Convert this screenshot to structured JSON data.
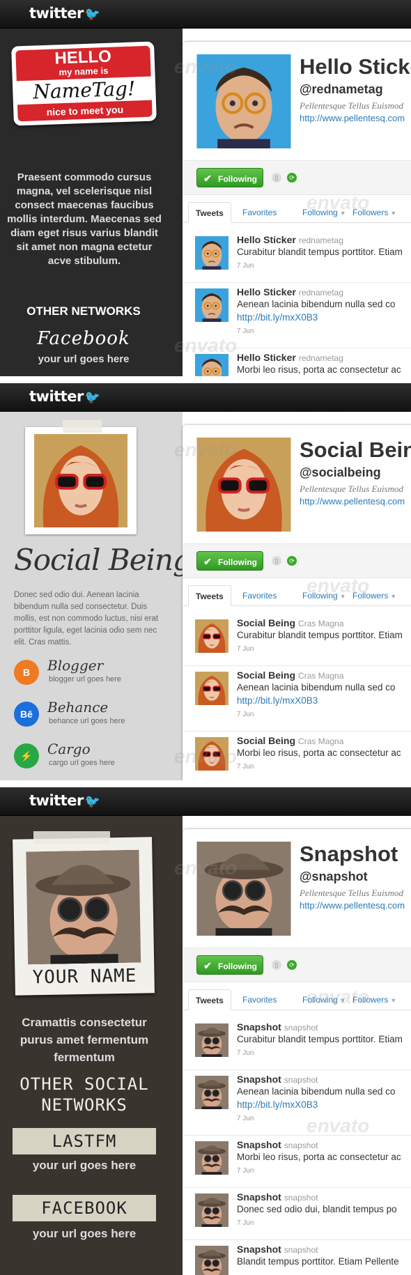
{
  "logo": "twitter",
  "common": {
    "following_btn": "Following",
    "tabs": [
      "Tweets",
      "Favorites",
      "Following",
      "Followers"
    ],
    "bio": "Pellentesque Tellus Euismod",
    "url": "http://www.pellentesq.com",
    "link": "http://bit.ly/mxX0B3",
    "date": "7 Jun",
    "watermark": "envato"
  },
  "colors": {
    "topbar": "#1a1a1a",
    "follow_green": "#3aa82a",
    "link_blue": "#2a7ab8",
    "nametag_red": "#d6252b"
  },
  "s1": {
    "tag_hello": "HELLO",
    "tag_myname": "my name is",
    "tag_name": "NameTag!",
    "tag_nice": "nice to meet you",
    "text": "Praesent commodo cursus magna, vel scelerisque nisl consect maecenas faucibus mollis interdum. Maecenas sed diam eget risus varius blandit sit amet non magna ectetur acve stibulum.",
    "other": "OTHER NETWORKS",
    "fb": "Facebook",
    "fb_url": "your url goes here",
    "profile_name": "Hello Sticker",
    "handle": "@rednametag",
    "tweets": [
      {
        "name": "Hello Sticker",
        "user": "rednametag",
        "text": "Curabitur blandit tempus porttitor. Etiam"
      },
      {
        "name": "Hello Sticker",
        "user": "rednametag",
        "text": "Aenean lacinia bibendum nulla sed co"
      },
      {
        "name": "Hello Sticker",
        "user": "rednametag",
        "text": "Morbi leo risus, porta ac consectetur ac"
      }
    ]
  },
  "s2": {
    "title": "Social Being",
    "text": "Donec sed odio dui. Aenean lacinia bibendum nulla sed consectetur. Duis mollis, est non commodo luctus, nisi erat porttitor ligula, eget lacinia odio sem nec elit. Cras mattis.",
    "networks": [
      {
        "name": "Blogger",
        "url": "blogger url goes here",
        "icon": "B",
        "color": "#f07a22"
      },
      {
        "name": "Behance",
        "url": "behance url goes here",
        "icon": "Bē",
        "color": "#1a6fdc"
      },
      {
        "name": "Cargo",
        "url": "cargo url goes here",
        "icon": "⚡",
        "color": "#27a845"
      }
    ],
    "profile_name": "Social Being",
    "handle": "@socialbeing",
    "tweets": [
      {
        "name": "Social Being",
        "user": "Cras Magna",
        "text": "Curabitur blandit tempus porttitor. Etiam"
      },
      {
        "name": "Social Being",
        "user": "Cras Magna",
        "text": "Aenean lacinia bibendum nulla sed co"
      },
      {
        "name": "Social Being",
        "user": "Cras Magna",
        "text": "Morbi leo risus, porta ac consectetur ac"
      }
    ]
  },
  "s3": {
    "caption": "YOUR NAME",
    "text": "Cramattis consectetur purus amet fermentum fermentum",
    "other": "OTHER SOCIAL NETWORKS",
    "band1": "LASTFM",
    "url1": "your url goes here",
    "band2": "FACEBOOK",
    "url2": "your url goes here",
    "profile_name": "Snapshot",
    "handle": "@snapshot",
    "tweets": [
      {
        "name": "Snapshot",
        "user": "snapshot",
        "text": "Curabitur blandit tempus porttitor. Etiam"
      },
      {
        "name": "Snapshot",
        "user": "snapshot",
        "text": "Aenean lacinia bibendum nulla sed co"
      },
      {
        "name": "Snapshot",
        "user": "snapshot",
        "text": "Morbi leo risus, porta ac consectetur ac"
      },
      {
        "name": "Snapshot",
        "user": "snapshot",
        "text": "Donec sed odio dui, blandit tempus po"
      },
      {
        "name": "Snapshot",
        "user": "snapshot",
        "text": "Blandit tempus porttitor. Etiam Pellente"
      }
    ]
  }
}
